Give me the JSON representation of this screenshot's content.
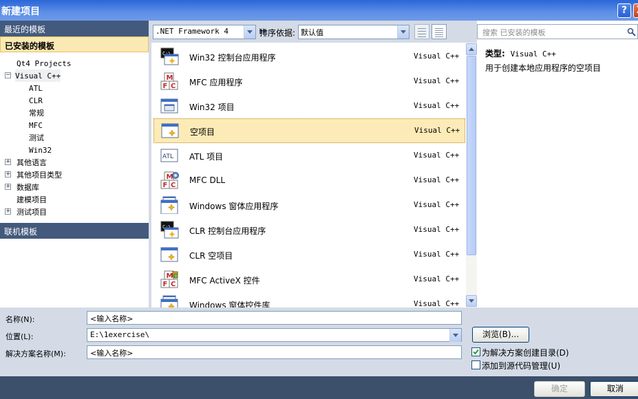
{
  "window": {
    "title": "新建项目",
    "help": "?",
    "close": "X"
  },
  "left": {
    "recent_header": "最近的模板",
    "installed_header": "已安装的模板",
    "online_header": "联机模板",
    "tree": [
      {
        "label": "Qt4 Projects",
        "expander": ""
      },
      {
        "label": "Visual C++",
        "expander": "−",
        "selected": true
      },
      {
        "label": "ATL",
        "expander": ""
      },
      {
        "label": "CLR",
        "expander": ""
      },
      {
        "label": "常规",
        "expander": ""
      },
      {
        "label": "MFC",
        "expander": ""
      },
      {
        "label": "测试",
        "expander": ""
      },
      {
        "label": "Win32",
        "expander": ""
      },
      {
        "label": "其他语言",
        "expander": "+"
      },
      {
        "label": "其他项目类型",
        "expander": "+"
      },
      {
        "label": "数据库",
        "expander": "+"
      },
      {
        "label": "建模项目",
        "expander": ""
      },
      {
        "label": "测试项目",
        "expander": "+"
      }
    ]
  },
  "toolbar": {
    "framework": ".NET Framework 4",
    "sort_label": "排序依据:",
    "sort_value": "默认值",
    "search_placeholder": "搜索 已安装的模板"
  },
  "templates": [
    {
      "name": "Win32 控制台应用程序",
      "type": "Visual C++",
      "icon": "console-app-icon"
    },
    {
      "name": "MFC 应用程序",
      "type": "Visual C++",
      "icon": "mfc-icon"
    },
    {
      "name": "Win32 项目",
      "type": "Visual C++",
      "icon": "window-icon"
    },
    {
      "name": "空项目",
      "type": "Visual C++",
      "icon": "empty-project-icon",
      "selected": true
    },
    {
      "name": "ATL 项目",
      "type": "Visual C++",
      "icon": "atl-icon"
    },
    {
      "name": "MFC DLL",
      "type": "Visual C++",
      "icon": "mfc-dll-icon"
    },
    {
      "name": "Windows 窗体应用程序",
      "type": "Visual C++",
      "icon": "forms-app-icon"
    },
    {
      "name": "CLR 控制台应用程序",
      "type": "Visual C++",
      "icon": "console-app-icon"
    },
    {
      "name": "CLR 空项目",
      "type": "Visual C++",
      "icon": "empty-project-icon"
    },
    {
      "name": "MFC ActiveX 控件",
      "type": "Visual C++",
      "icon": "mfc-activex-icon"
    },
    {
      "name": "Windows 窗体控件库",
      "type": "Visual C++",
      "icon": "forms-app-icon"
    }
  ],
  "details": {
    "type_label": "类型:",
    "type_value": "Visual C++",
    "description": "用于创建本地应用程序的空项目"
  },
  "form": {
    "name_label": "名称(N):",
    "name_value": "<输入名称>",
    "location_label": "位置(L):",
    "location_value": "E:\\1exercise\\",
    "solution_label": "解决方案名称(M):",
    "solution_value": "<输入名称>",
    "browse_label": "浏览(B)...",
    "create_dir_label": "为解决方案创建目录(D)",
    "create_dir_checked": true,
    "source_control_label": "添加到源代码管理(U)",
    "source_control_checked": false
  },
  "buttons": {
    "ok": "确定",
    "cancel": "取消"
  }
}
